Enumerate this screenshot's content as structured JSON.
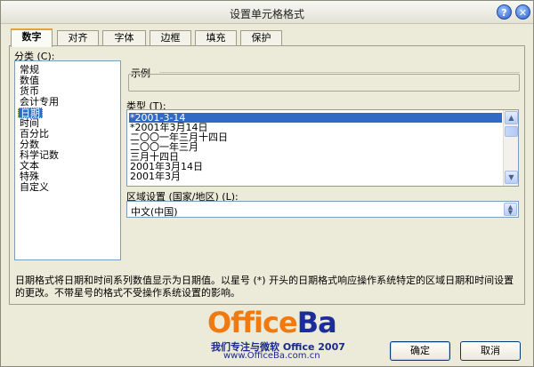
{
  "window": {
    "title": "设置单元格格式"
  },
  "titlebar": {
    "help_glyph": "?",
    "close_glyph": "✕"
  },
  "tabs": [
    {
      "label": "数字",
      "active": true
    },
    {
      "label": "对齐"
    },
    {
      "label": "字体"
    },
    {
      "label": "边框"
    },
    {
      "label": "填充"
    },
    {
      "label": "保护"
    }
  ],
  "category": {
    "label_prefix": "分类 (",
    "label_key": "C",
    "label_suffix": "):",
    "items": [
      "常规",
      "数值",
      "货币",
      "会计专用",
      "日期",
      "时间",
      "百分比",
      "分数",
      "科学记数",
      "文本",
      "特殊",
      "自定义"
    ],
    "selected": "日期"
  },
  "sample": {
    "label": "示例",
    "value": ""
  },
  "type": {
    "label_prefix": "类型 (",
    "label_key": "T",
    "label_suffix": "):",
    "items": [
      "*2001-3-14",
      "*2001年3月14日",
      "二〇〇一年三月十四日",
      "二〇〇一年三月",
      "三月十四日",
      "2001年3月14日",
      "2001年3月"
    ],
    "selected": "*2001-3-14",
    "scroll_up_glyph": "▲",
    "scroll_down_glyph": "▼"
  },
  "locale": {
    "label_prefix": "区域设置 (国家/地区) (",
    "label_key": "L",
    "label_suffix": "):",
    "value": "中文(中国)",
    "dropdown_glyph_up": "▲",
    "dropdown_glyph_down": "▼"
  },
  "description": "日期格式将日期和时间系列数值显示为日期值。以星号 (*) 开头的日期格式响应操作系统特定的区域日期和时间设置的更改。不带星号的格式不受操作系统设置的影响。",
  "watermark": {
    "logo_parts": [
      "Office",
      "Ba"
    ],
    "tagline": "我们专注与微软 Office 2007",
    "url": "www.OfficeBa.com.cn"
  },
  "buttons": {
    "ok": "确定",
    "cancel": "取消"
  },
  "colors": {
    "selection": "#316ac5",
    "tab_accent": "#e8a13a",
    "logo_orange": "#f07a10",
    "logo_blue": "#1b2d9a"
  }
}
